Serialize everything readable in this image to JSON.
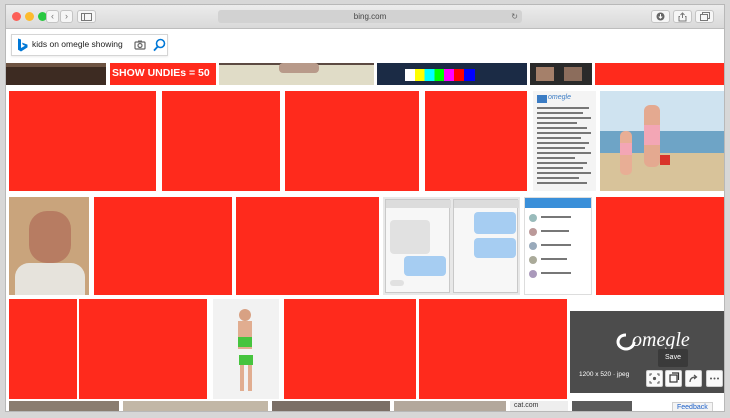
{
  "browser": {
    "url": "bing.com",
    "nav_back": "‹",
    "nav_forward": "›",
    "reload": "↻"
  },
  "search": {
    "query": "kids on omegle showing"
  },
  "results": {
    "banner_text": "SHOW UNDIEs = 50",
    "omegle_logo_text": "omegle",
    "small_omegle_text": "omegle",
    "image_info": "1200 x 520 · jpeg",
    "save_tooltip": "Save",
    "feedback_label": "Feedback",
    "tiny_caption": "cat.com"
  },
  "colors": {
    "placeholder_red": "#ff2a1c",
    "bing_blue": "#0078d7",
    "omegle_bg": "#4c4c4c"
  },
  "icons": [
    "bing-logo-icon",
    "camera-icon",
    "search-icon",
    "back-icon",
    "forward-icon",
    "sidebar-icon",
    "download-icon",
    "share-icon",
    "tabs-icon",
    "visual-search-icon",
    "save-icon",
    "share-result-icon",
    "more-icon"
  ]
}
